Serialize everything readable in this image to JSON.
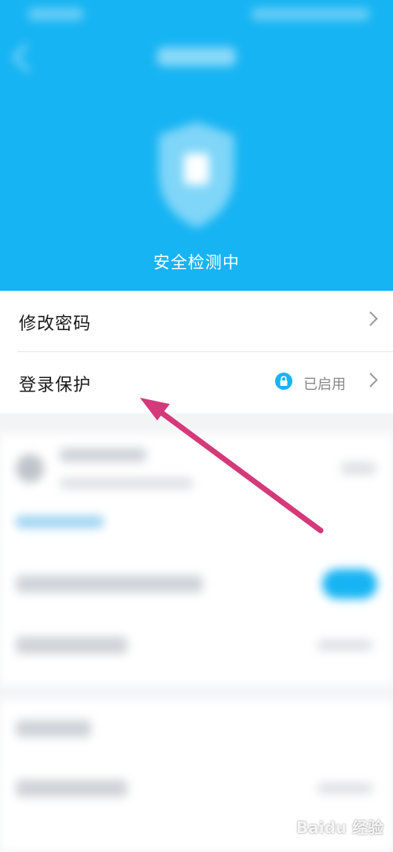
{
  "header": {
    "status_text": "安全检测中",
    "bg_color": "#17b4f3"
  },
  "menu": {
    "items": [
      {
        "label": "修改密码",
        "status": ""
      },
      {
        "label": "登录保护",
        "status": "已启用",
        "icon": "lock-icon"
      }
    ]
  },
  "watermark": {
    "text": "Baidu 经验"
  },
  "colors": {
    "accent": "#17b4f3",
    "arrow": "#d4397a"
  }
}
